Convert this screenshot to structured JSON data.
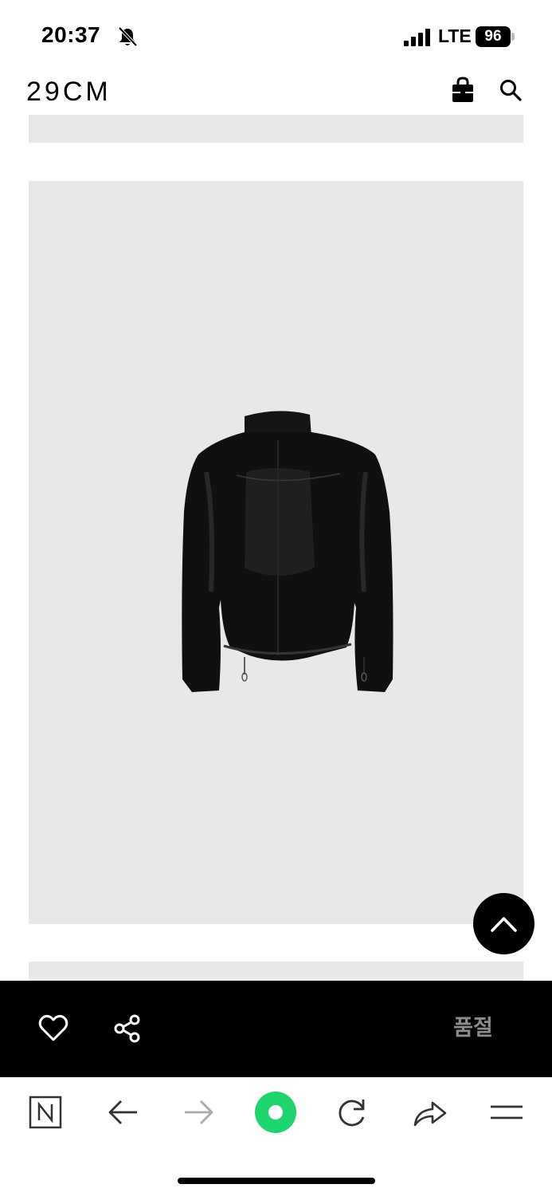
{
  "status_bar": {
    "time": "20:37",
    "network": "LTE",
    "battery": "96"
  },
  "header": {
    "logo": "29CM"
  },
  "purchase_bar": {
    "soldout_label": "품절"
  },
  "colors": {
    "image_background": "#e8e8e8",
    "bar_background": "#000000",
    "soldout_text": "#8c8c8c",
    "accent_green": "#1ed46d"
  },
  "icons": [
    "bell-off-icon",
    "signal-icon",
    "shopping-bag-icon",
    "search-icon",
    "chevron-up-icon",
    "heart-icon",
    "share-icon",
    "naver-n-icon",
    "back-arrow-icon",
    "forward-arrow-icon",
    "green-dot-icon",
    "reload-icon",
    "share-arrow-icon",
    "menu-icon"
  ]
}
